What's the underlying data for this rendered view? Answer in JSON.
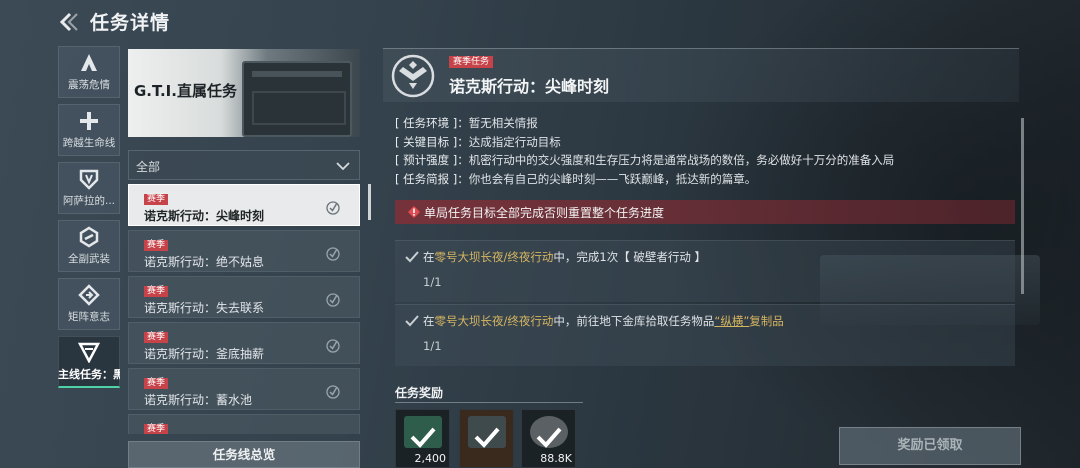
{
  "header": {
    "title": "任务详情"
  },
  "sidebar": {
    "items": [
      {
        "label": "震荡危情",
        "icon": "a-shield-icon"
      },
      {
        "label": "跨越生命线",
        "icon": "medic-cross-icon"
      },
      {
        "label": "阿萨拉的...",
        "icon": "badge-shield-icon"
      },
      {
        "label": "全副武装",
        "icon": "gear-link-icon"
      },
      {
        "label": "矩阵意志",
        "icon": "diamond-arrow-icon"
      },
      {
        "label": "主线任务：黑夜",
        "icon": "v-chevron-icon"
      }
    ]
  },
  "banner": {
    "title": "G.T.I.直属任务"
  },
  "filter": {
    "value": "全部"
  },
  "tasks": [
    {
      "tag": "赛季",
      "name": "诺克斯行动：尖峰时刻"
    },
    {
      "tag": "赛季",
      "name": "诺克斯行动：绝不姑息"
    },
    {
      "tag": "赛季",
      "name": "诺克斯行动：失去联系"
    },
    {
      "tag": "赛季",
      "name": "诺克斯行动：釜底抽薪"
    },
    {
      "tag": "赛季",
      "name": "诺克斯行动：蓄水池"
    },
    {
      "tag": "赛季",
      "name": ""
    }
  ],
  "summary_button": "任务线总览",
  "detail": {
    "season_tag": "赛季任务",
    "title": "诺克斯行动：尖峰时刻",
    "rows": [
      {
        "key": "[ 任务环境 ]",
        "value": "暂无相关情报"
      },
      {
        "key": "[ 关键目标 ]",
        "value": "达成指定行动目标"
      },
      {
        "key": "[ 预计强度 ]",
        "value": "机密行动中的交火强度和生存压力将是通常战场的数倍，务必做好十万分的准备入局"
      },
      {
        "key": "[ 任务简报 ]",
        "value": "你也会有自己的尖峰时刻——飞跃巅峰，抵达新的篇章。"
      }
    ],
    "warning": "单局任务目标全部完成否则重置整个任务进度",
    "objectives": [
      {
        "pre": "在",
        "highlight": "零号大坝长夜/终夜行动",
        "mid": "中，完成1次【 破壁者行动 】",
        "link": "",
        "post": "",
        "progress": "1/1"
      },
      {
        "pre": "在",
        "highlight": "零号大坝长夜/终夜行动",
        "mid": "中，前往地下金库拾取任务物品",
        "link": "“纵横”",
        "post": "复制品",
        "progress": "1/1"
      }
    ]
  },
  "rewards": {
    "title": "任务奖励",
    "items": [
      {
        "count": "2,400",
        "icon": "green-token-icon"
      },
      {
        "count": "",
        "icon": "item-box-icon"
      },
      {
        "count": "88.8K",
        "icon": "coin-icon"
      }
    ]
  },
  "claim_button": "奖励已领取",
  "colors": {
    "accent": "#4fd1a5",
    "tag_red": "#c7434a",
    "highlight": "#d6b561"
  }
}
